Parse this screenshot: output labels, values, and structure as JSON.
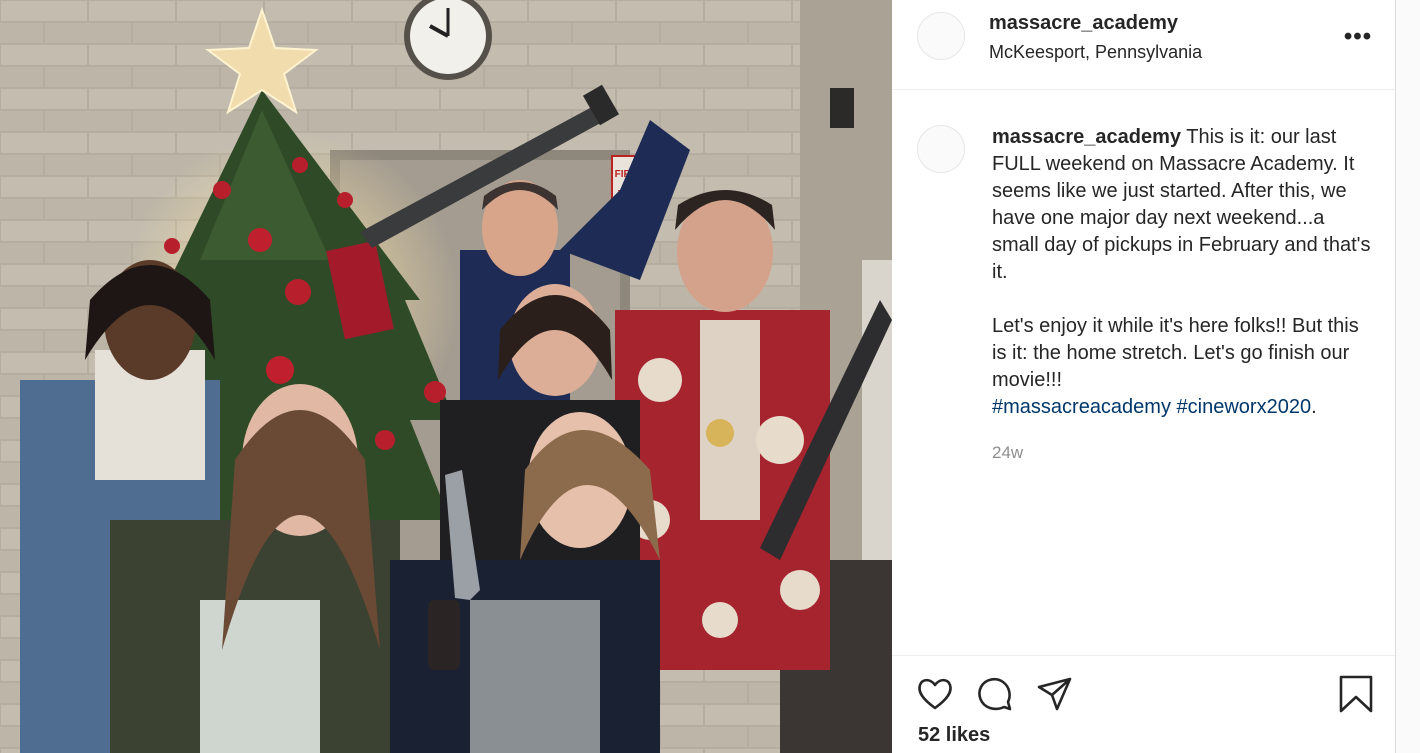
{
  "photo": {
    "alt_icon": "group-photo-image",
    "clock_icon": "wall-clock-icon",
    "tree_icon": "christmas-tree-icon",
    "sign_text": "FIRE"
  },
  "header": {
    "username": "massacre_academy",
    "location": "McKeesport, Pennsylvania",
    "more": "•••"
  },
  "caption": {
    "username": "massacre_academy",
    "paragraph1": "This is it: our last FULL weekend on Massacre Academy. It seems like we just started. After this, we have one major day next weekend...a small day of pickups in February and that's it.",
    "paragraph2": "Let's enjoy it while it's here folks!! But this is it: the home stretch. Let's go finish our movie!!!",
    "hashtag1": "#massacreacademy",
    "hashtag2": "#cineworx2020",
    "trailing": ".",
    "time": "24w"
  },
  "actions": {
    "likes": "52 likes",
    "icons": [
      "heart-icon",
      "comment-icon",
      "share-icon",
      "bookmark-icon"
    ]
  },
  "colors": {
    "text": "#262626",
    "secondary": "#8e8e8e",
    "link": "#00376b",
    "border": "#dbdbdb"
  }
}
